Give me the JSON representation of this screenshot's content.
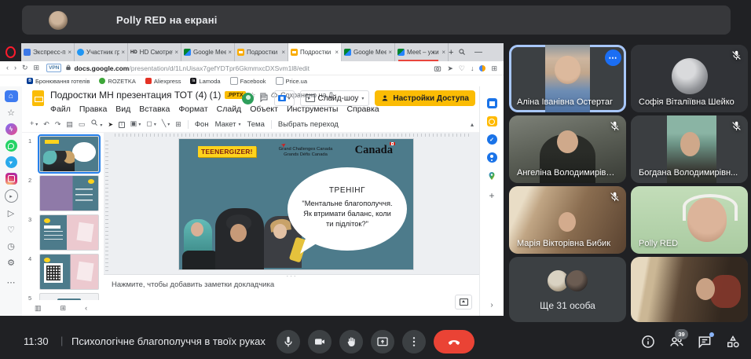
{
  "meet": {
    "banner": {
      "text": "Polly RED на екрані"
    },
    "participants": [
      {
        "name": "Аліна Іванівна Остертаг",
        "scene": "alina",
        "muted": false,
        "active": true,
        "menu": true,
        "type": "video"
      },
      {
        "name": "Софія Віталіївна Шейко",
        "scene": "sofia",
        "muted": true,
        "active": false,
        "menu": false,
        "type": "avatar"
      },
      {
        "name": "Ангеліна Володимирівн...",
        "scene": "anhelina",
        "muted": true,
        "active": false,
        "menu": false,
        "type": "video"
      },
      {
        "name": "Богдана Володимирівн...",
        "scene": "bohdana",
        "muted": true,
        "active": false,
        "menu": false,
        "type": "video"
      },
      {
        "name": "Марія Вікторівна Бибик",
        "scene": "maria",
        "muted": true,
        "active": false,
        "menu": false,
        "type": "video"
      },
      {
        "name": "Polly RED",
        "scene": "polly",
        "muted": false,
        "active": false,
        "menu": false,
        "type": "video"
      },
      {
        "name": "Ще 31 особа",
        "scene": "overflow",
        "muted": false,
        "active": false,
        "menu": false,
        "type": "overflow"
      },
      {
        "name": "",
        "scene": "room",
        "muted": false,
        "active": false,
        "menu": false,
        "type": "video"
      }
    ],
    "bottom": {
      "time": "11:30",
      "title": "Психологічне благополуччя в твоїх руках",
      "controls": [
        {
          "id": "mic",
          "name": "microphone-button"
        },
        {
          "id": "cam",
          "name": "camera-button"
        },
        {
          "id": "hand",
          "name": "raise-hand-button"
        },
        {
          "id": "present",
          "name": "present-screen-button"
        },
        {
          "id": "more",
          "name": "more-options-button"
        },
        {
          "id": "end",
          "name": "end-call-button"
        }
      ],
      "right_icons": [
        {
          "id": "info",
          "name": "meeting-details-button"
        },
        {
          "id": "people",
          "name": "participants-button",
          "badge": "39"
        },
        {
          "id": "chat",
          "name": "chat-button",
          "dot": true
        },
        {
          "id": "activities",
          "name": "activities-button"
        }
      ]
    }
  },
  "browser": {
    "tabs": [
      {
        "title": "Экспресс-пан",
        "icon": "speed-dial"
      },
      {
        "title": "Участник гру",
        "icon": "circle-blue"
      },
      {
        "title": "HD Смотреть фи",
        "icon": "hd"
      },
      {
        "title": "Google Meet",
        "icon": "meet"
      },
      {
        "title": "Подростки М",
        "icon": "slides"
      },
      {
        "title": "Подростки М",
        "icon": "slides",
        "active": true
      },
      {
        "title": "Google Meet",
        "icon": "meet"
      },
      {
        "title": "Meet – ужи",
        "icon": "meet",
        "progress": true
      }
    ],
    "new_tab": "+",
    "window_controls": [
      "search",
      "minimize",
      "maximize",
      "close"
    ],
    "nav_icons": [
      "back",
      "forward",
      "reload",
      "tab-tiling"
    ],
    "vpn_badge": "VPN",
    "url_host": "docs.google.com",
    "url_path": "/presentation/d/1LnUisax7gefYDTpr6GkmmxcDXSvm1l8/edit",
    "address_right_icons": [
      "snapshot",
      "send-to-flow",
      "favorites-heart",
      "downloads",
      "extension",
      "panels"
    ],
    "bookmarks": [
      {
        "label": "Бронювання готелів",
        "icon": "booking"
      },
      {
        "label": "ROZETKA",
        "icon": "rozetka"
      },
      {
        "label": "Aliexpress",
        "icon": "aliexpress"
      },
      {
        "label": "Lamoda",
        "icon": "lamoda"
      },
      {
        "label": "Facebook",
        "icon": "page"
      },
      {
        "label": "Price.ua",
        "icon": "page"
      }
    ],
    "sidebar_icons": [
      "home",
      "bookmarks-star",
      "messenger",
      "whatsapp",
      "telegram",
      "instagram",
      "player",
      "flow",
      "likes",
      "history",
      "settings",
      "more"
    ]
  },
  "slides": {
    "doc_title": "Подростки МН презентация ТОТ (4) (1)",
    "file_badge": ".PPTX",
    "saved_status": "Сохранено на Д",
    "menus": [
      "Файл",
      "Правка",
      "Вид",
      "Вставка",
      "Формат",
      "Слайд",
      "Объект",
      "Инструменты",
      "Справка"
    ],
    "toolbar_icons": [
      "new-slide",
      "undo",
      "redo",
      "print",
      "paint-format",
      "zoom",
      "select",
      "text-box",
      "image",
      "shape",
      "line",
      "comment"
    ],
    "toolbar_labels": {
      "background": "Фон",
      "layout": "Макет",
      "theme": "Тема",
      "transition": "Выбрать переход"
    },
    "slideshow_button": "Слайд-шоу",
    "share_button": "Настройки Доступа",
    "notes_placeholder": "Нажмите, чтобы добавить заметки докладчика",
    "thumbnails": [
      {
        "num": "1",
        "scene": "s1",
        "selected": true
      },
      {
        "num": "2",
        "scene": "s2",
        "selected": false
      },
      {
        "num": "3",
        "scene": "s3",
        "selected": false
      },
      {
        "num": "4",
        "scene": "s4",
        "selected": false
      },
      {
        "num": "5",
        "scene": "s5",
        "selected": false
      }
    ],
    "rail_icons": [
      "profile-avatar",
      "calendar",
      "keep",
      "tasks",
      "contacts",
      "maps",
      "add",
      "collapse"
    ]
  },
  "slide": {
    "brand_badge": "TEENERGIZER!",
    "logo_line1": "Grand Challenges Canada",
    "logo_line2": "Grands Défis Canada",
    "canada_wordmark": "Canada",
    "bubble_title": "ТРЕНІНГ",
    "bubble_text": "\"Ментальне благополуччя. Як втримати баланс, коли ти підліток?\""
  },
  "colors": {
    "accent_blue": "#1a73e8",
    "share_yellow": "#fbbc04",
    "end_call_red": "#ea4335",
    "slide_teal": "#4d7b8b",
    "badge_yellow": "#ffd31c",
    "active_speaker_border": "#a8c7fa"
  }
}
